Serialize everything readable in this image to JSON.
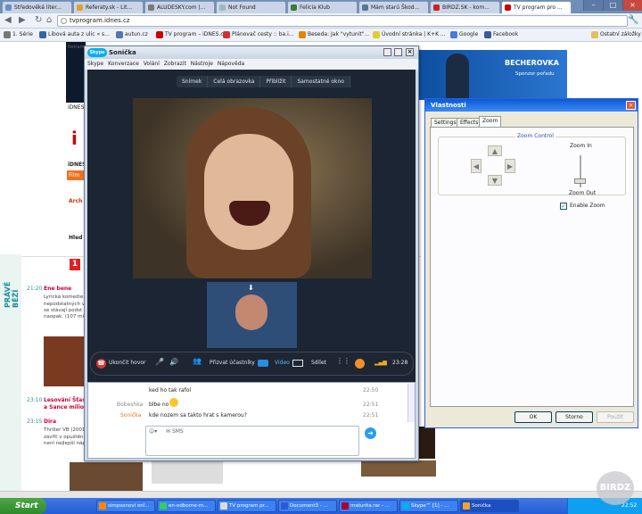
{
  "browser": {
    "tabs": [
      {
        "label": "Středověká liter...",
        "color": "#6a8fc8"
      },
      {
        "label": "Referaty.sk - Lit...",
        "color": "#e0a030"
      },
      {
        "label": "ALUDESKY.com |...",
        "color": "#7a7a7a"
      },
      {
        "label": "Not Found",
        "color": "#9bb"
      },
      {
        "label": "Felicia Klub",
        "color": "#3a7a3a"
      },
      {
        "label": "Mám starú Škod...",
        "color": "#557799"
      },
      {
        "label": "BIRDZ.SK - kom...",
        "color": "#cc2222"
      },
      {
        "label": "TV program pro ...",
        "color": "#cc0000"
      }
    ],
    "url": "tvprogram.idnes.cz",
    "bookmarks": [
      {
        "label": "1. Série",
        "color": "#777"
      },
      {
        "label": "Libová auta z ulic « s...",
        "color": "#3366aa"
      },
      {
        "label": "autun.cz",
        "color": "#5577aa"
      },
      {
        "label": "TV program – iDNES.cz",
        "color": "#cc0000"
      },
      {
        "label": "Plánovač cesty :: ba.i...",
        "color": "#cc3333"
      },
      {
        "label": "Beseda: Jak \"vytunit\"...",
        "color": "#dd8800"
      },
      {
        "label": "Úvodní stránka | K+K ...",
        "color": "#ddcc33"
      },
      {
        "label": "Google",
        "color": "#4a7ae0"
      },
      {
        "label": "Facebook",
        "color": "#3b5998"
      },
      {
        "label": "Ostatní záložky",
        "color": "#e0c060"
      }
    ]
  },
  "page": {
    "reklama": "Reklama",
    "idnes": "iDNES",
    "film": "Film",
    "arch": "Arch",
    "hled": "Hled",
    "prave_bezi": "PRÁVĚ BĚŽÍ",
    "badge": "1",
    "items": [
      {
        "time": "21:20",
        "title": "Ene bene",
        "text": "Lyrická komedie",
        "rows": [
          "nepodstatných v",
          "se stávají podst",
          "naopak. (107 mi"
        ]
      },
      {
        "time": "23:10",
        "title": "Lesování Šťas",
        "sub": "a Sance milion",
        "text": ""
      },
      {
        "time": "23:15",
        "title": "Dira",
        "text": "Thriller VB (2001",
        "rows": [
          "zavřít v opuštěn",
          "není nejlepší náp"
        ]
      }
    ],
    "banner": {
      "brand": "BECHEROVKA",
      "sub": "Sponzor pořadu"
    }
  },
  "skype": {
    "title": "Sonička",
    "menu": [
      "Skype",
      "Konverzace",
      "Volání",
      "Zobrazit",
      "Nástroje",
      "Nápověda"
    ],
    "video_tabs": [
      "Snímek",
      "Celá obrazovka",
      "Přiblížit",
      "Samostatné okno"
    ],
    "controls": {
      "end_call": "Ukončit hovor",
      "invite": "Přizvat účastníky",
      "video": "Video",
      "share": "Sdílet",
      "duration": "23:28"
    },
    "chat": [
      {
        "name": "",
        "text": "ked ho tak rafol",
        "time": "22:50"
      },
      {
        "name": "Bobeshka",
        "text": "blbe no",
        "time": "22:51"
      },
      {
        "name": "Sonička",
        "text": "kde nozem sa takto hrat s kamerou?",
        "time": "22:51"
      }
    ],
    "input_placeholder": "SMS"
  },
  "properties": {
    "title": "Vlastnosti",
    "tabs": [
      "Settings",
      "Effects",
      "Zoom"
    ],
    "group": "Zoom Control",
    "zoom_in": "Zoom In",
    "zoom_out": "Zoom Out",
    "enable_zoom": "Enable Zoom",
    "enable_zoom_checked": true,
    "buttons": {
      "ok": "OK",
      "cancel": "Storno",
      "apply": "Použít"
    }
  },
  "taskbar": {
    "start": "Start",
    "items": [
      {
        "label": "simpsonovi onl...",
        "color": "#ff8800"
      },
      {
        "label": "en-odborne-m...",
        "color": "#3c6"
      },
      {
        "label": "TV program pr...",
        "color": "#ddd"
      },
      {
        "label": "Document3 - ...",
        "color": "#2a5bd7"
      },
      {
        "label": "maturita.rar - ...",
        "color": "#a03"
      },
      {
        "label": "Skype™ [1] - ...",
        "color": "#00aff0"
      },
      {
        "label": "Sonička",
        "color": "#f0a030"
      }
    ],
    "clock": "22:52"
  },
  "watermark": "BIRDZ"
}
